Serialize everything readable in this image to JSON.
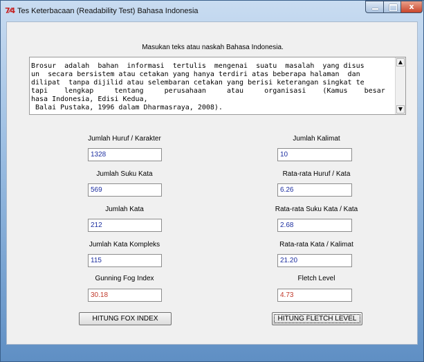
{
  "window": {
    "icon_text": "7⁄4",
    "title": "Tes Keterbacaan (Readability Test) Bahasa Indonesia",
    "close_glyph": "x"
  },
  "prompt": "Masukan teks atau naskah Bahasa Indonesia.",
  "input_text_lines": [
    "Brosur  adalah  bahan  informasi  tertulis  mengenai  suatu  masalah  yang disus",
    "un  secara bersistem atau cetakan yang hanya terdiri atas beberapa halaman  dan",
    "dilipat  tanpa dijilid atau selembaran cetakan yang berisi keterangan singkat te",
    "tapi    lengkap     tentang     perusahaan     atau     organisasi    (Kamus    besar    Ba",
    "hasa Indonesia, Edisi Kedua,",
    " Balai Pustaka, 1996 dalam Dharmasraya, 2008)."
  ],
  "scroll": {
    "up": "▲",
    "down": "▼"
  },
  "left_stats": [
    {
      "label": "Jumlah Huruf / Karakter",
      "value": "1328"
    },
    {
      "label": "Jumlah Suku Kata",
      "value": "569"
    },
    {
      "label": "Jumlah Kata",
      "value": "212"
    },
    {
      "label": "Jumlah Kata Kompleks",
      "value": "115"
    },
    {
      "label": "Gunning Fog Index",
      "value": "30.18"
    }
  ],
  "right_stats": [
    {
      "label": "Jumlah Kalimat",
      "value": "10"
    },
    {
      "label": "Rata-rata Huruf / Kata",
      "value": "6.26"
    },
    {
      "label": "Rata-rata Suku Kata / Kata",
      "value": "2.68"
    },
    {
      "label": "Rata-rata Kata / Kalimat",
      "value": "21.20"
    },
    {
      "label": "Fletch Level",
      "value": "4.73"
    }
  ],
  "buttons": {
    "fox": "HITUNG FOX INDEX",
    "fletch": "HITUNG FLETCH LEVEL"
  },
  "colors": {
    "value_blue": "#1d2fa0",
    "result_red": "#c0392b"
  }
}
